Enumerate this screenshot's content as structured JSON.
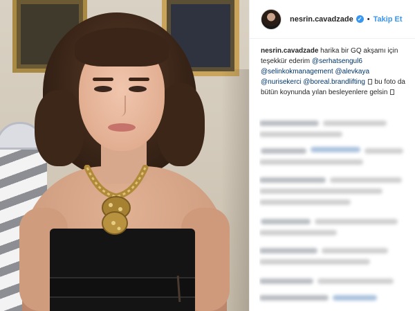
{
  "post": {
    "author": {
      "username": "nesrin.cavadzade",
      "verified_icon": "verified-check-icon",
      "follow_label": "Takip Et",
      "separator": "•"
    },
    "caption": {
      "username": "nesrin.cavadzade",
      "text_1": " harika bir GQ akşamı için teşekkür ederim ",
      "mention_1": "@serhatsengul6",
      "mention_2": "@selinkokmanagement",
      "mention_3": "@alevkaya",
      "mention_4": "@nurisekerci",
      "mention_5": "@boreal.brandlifting",
      "text_2": " bu foto da bütün koynunda yılan besleyenlere gelsin "
    },
    "colors": {
      "link": "#003569",
      "follow": "#3897f0",
      "text": "#262626"
    }
  }
}
